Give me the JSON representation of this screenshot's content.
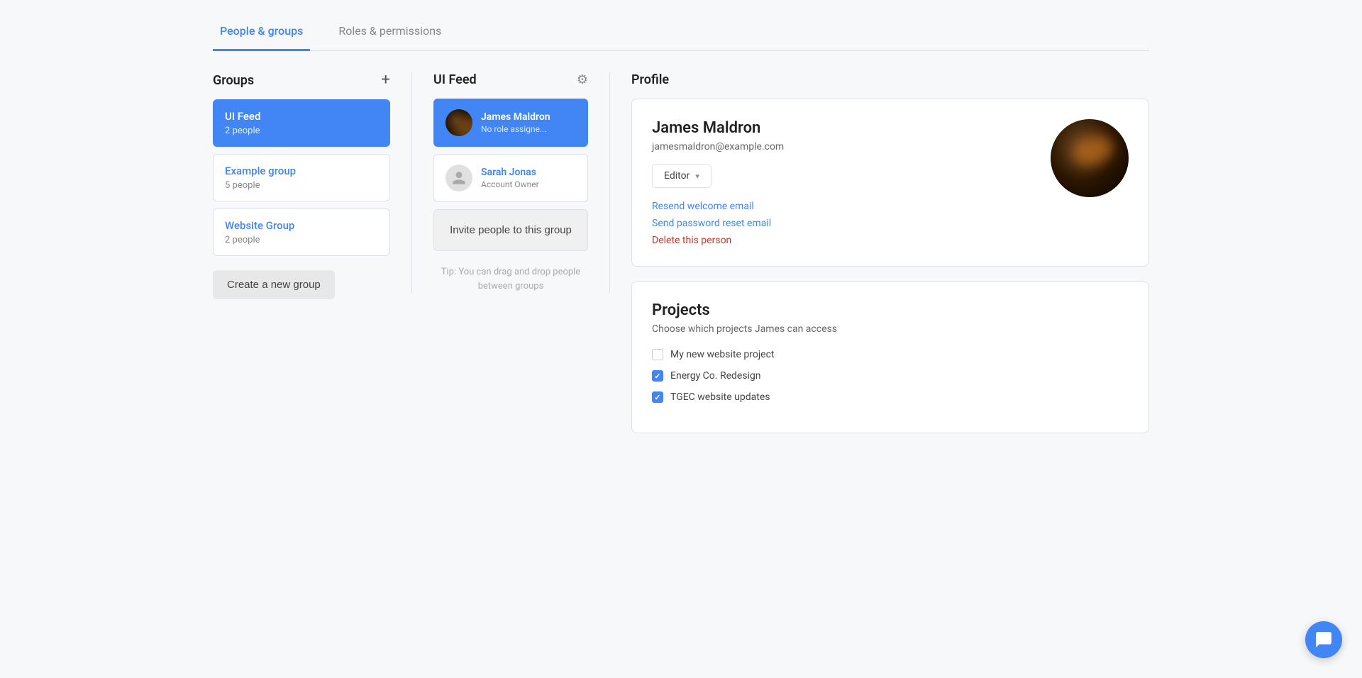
{
  "tabs": [
    {
      "id": "people-groups",
      "label": "People & groups",
      "active": true
    },
    {
      "id": "roles-permissions",
      "label": "Roles & permissions",
      "active": false
    }
  ],
  "groups_panel": {
    "title": "Groups",
    "add_icon": "+",
    "items": [
      {
        "id": "ui-feed",
        "name": "UI Feed",
        "count": "2 people",
        "active": true
      },
      {
        "id": "example-group",
        "name": "Example group",
        "count": "5 people",
        "active": false
      },
      {
        "id": "website-group",
        "name": "Website Group",
        "count": "2 people",
        "active": false
      }
    ],
    "create_button_label": "Create a new group"
  },
  "feed_panel": {
    "title": "UI Feed",
    "people": [
      {
        "id": "james-maldron",
        "name": "James Maldron",
        "role": "No role assigne...",
        "active": true,
        "has_photo": true
      },
      {
        "id": "sarah-jonas",
        "name": "Sarah Jonas",
        "role": "Account Owner",
        "active": false,
        "has_photo": false
      }
    ],
    "invite_button_label": "Invite people to this group",
    "tip_text": "Tip: You can drag and drop people between groups"
  },
  "profile_panel": {
    "title": "Profile",
    "person": {
      "name": "James Maldron",
      "email": "jamesmaldron@example.com",
      "role": "Editor",
      "role_dropdown_icon": "▾"
    },
    "links": [
      {
        "id": "resend-welcome",
        "label": "Resend welcome email",
        "type": "normal"
      },
      {
        "id": "send-password-reset",
        "label": "Send password reset email",
        "type": "normal"
      },
      {
        "id": "delete-person",
        "label": "Delete this person",
        "type": "danger"
      }
    ],
    "projects": {
      "title": "Projects",
      "subtitle_prefix": "Choose which projects ",
      "subtitle_person": "James",
      "subtitle_suffix": " can access",
      "items": [
        {
          "id": "my-new-website",
          "label": "My new website project",
          "checked": false
        },
        {
          "id": "energy-co",
          "label": "Energy Co. Redesign",
          "checked": true
        },
        {
          "id": "tgec-website",
          "label": "TGEC website updates",
          "checked": true
        }
      ]
    }
  },
  "chat_bubble": {
    "aria_label": "Open chat"
  }
}
